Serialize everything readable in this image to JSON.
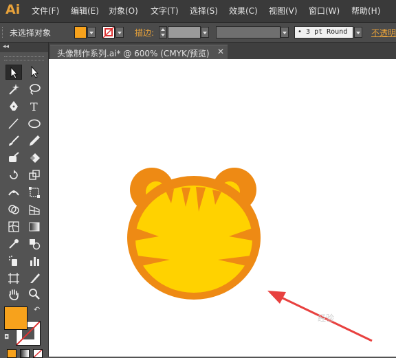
{
  "app": {
    "logo": "Ai"
  },
  "menu": [
    {
      "label": "文件(F)"
    },
    {
      "label": "编辑(E)"
    },
    {
      "label": "对象(O)"
    },
    {
      "label": "文字(T)"
    },
    {
      "label": "选择(S)"
    },
    {
      "label": "效果(C)"
    },
    {
      "label": "视图(V)"
    },
    {
      "label": "窗口(W)"
    },
    {
      "label": "帮助(H)"
    }
  ],
  "control_bar": {
    "selection_status": "未选择对象",
    "fill_color": "#f7a21c",
    "stroke_label": "描边:",
    "stroke_profile": "• 3 pt Round",
    "opacity_label": "不透明"
  },
  "document": {
    "tab_title": "头像制作系列.ai* @ 600% (CMYK/预览)",
    "close_glyph": "✕"
  },
  "tools": {
    "fill_color": "#f7a21c",
    "stroke_color": "#000000"
  },
  "artwork": {
    "outer_color": "#ee8a14",
    "face_color": "#ffd200",
    "arrow_color": "#e8413f"
  },
  "watermark": "经验"
}
